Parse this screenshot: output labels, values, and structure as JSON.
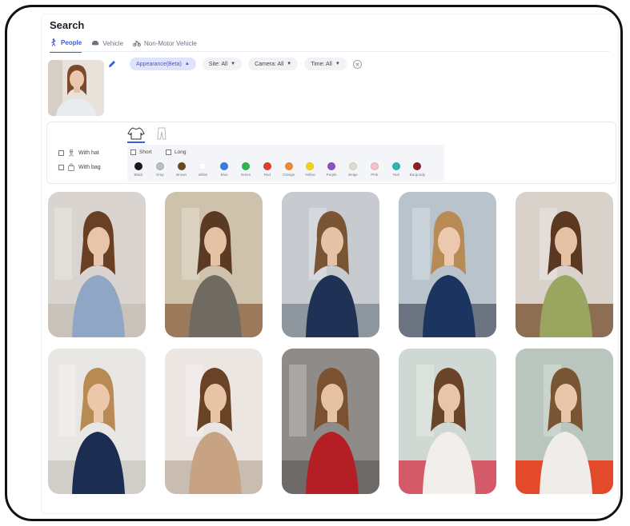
{
  "header": {
    "title": "Search"
  },
  "tabs": [
    {
      "label": "People",
      "icon": "person-icon",
      "active": true
    },
    {
      "label": "Vehicle",
      "icon": "car-icon",
      "active": false
    },
    {
      "label": "Non-Motor Vehicle",
      "icon": "motorcycle-icon",
      "active": false
    }
  ],
  "filters": {
    "appearance": "Appearance(Beta)",
    "site": "Site: All",
    "camera": "Camera: All",
    "time": "Time: All"
  },
  "accessories": {
    "with_hat": "With hat",
    "with_bag": "With bag"
  },
  "garment": {
    "short": "Short",
    "long": "Long",
    "colors": [
      {
        "name": "Black",
        "hex": "#1a1a1a"
      },
      {
        "name": "Gray",
        "hex": "#b9bcc2"
      },
      {
        "name": "Brown",
        "hex": "#6b4a1e"
      },
      {
        "name": "White",
        "hex": "#ffffff"
      },
      {
        "name": "Blue",
        "hex": "#3d7be0"
      },
      {
        "name": "Green",
        "hex": "#34b34a"
      },
      {
        "name": "Red",
        "hex": "#e33b2e"
      },
      {
        "name": "Orange",
        "hex": "#f08a3a"
      },
      {
        "name": "Yellow",
        "hex": "#f2d21b"
      },
      {
        "name": "Purple",
        "hex": "#8b4fc7"
      },
      {
        "name": "Beige",
        "hex": "#dcdccb"
      },
      {
        "name": "Pink",
        "hex": "#f4c2c8"
      },
      {
        "name": "Teal",
        "hex": "#2fb3b0"
      },
      {
        "name": "Burgundy",
        "hex": "#8e1d25"
      }
    ]
  },
  "results": [
    {
      "bg": "#d9d4cf",
      "floor": "#c9c2bb",
      "hair": "#6a4024",
      "top": "#8fa7c4",
      "skin": "#e8c5aa"
    },
    {
      "bg": "#cfc2ad",
      "floor": "#9a7a5a",
      "hair": "#5a3a22",
      "top": "#6f6a62",
      "skin": "#e5c2a4"
    },
    {
      "bg": "#c7cbd0",
      "floor": "#8f979e",
      "hair": "#7a5534",
      "top": "#1f3256",
      "skin": "#e6c3a6"
    },
    {
      "bg": "#b9c3cc",
      "floor": "#6b7480",
      "hair": "#b88a54",
      "top": "#1c3560",
      "skin": "#ecc9ae"
    },
    {
      "bg": "#d8d2cb",
      "floor": "#8e6e52",
      "hair": "#5a3822",
      "top": "#9aa560",
      "skin": "#e6c2a5"
    },
    {
      "bg": "#e9e7e4",
      "floor": "#d1cec9",
      "hair": "#b88a54",
      "top": "#1c2d52",
      "skin": "#ecc8ab"
    },
    {
      "bg": "#ece6e2",
      "floor": "#c9bdb2",
      "hair": "#6a4226",
      "top": "#c8a383",
      "skin": "#e8c4a6"
    },
    {
      "bg": "#8e8b88",
      "floor": "#6d6a67",
      "hair": "#7a5232",
      "top": "#b31f24",
      "skin": "#e6c2a4"
    },
    {
      "bg": "#cfd8d2",
      "floor": "#d45a6a",
      "hair": "#6a4428",
      "top": "#f2eeec",
      "skin": "#e8c5a8"
    },
    {
      "bg": "#b9c6bd",
      "floor": "#e24a2a",
      "hair": "#7a5534",
      "top": "#f0ecea",
      "skin": "#e9c6a9"
    }
  ]
}
